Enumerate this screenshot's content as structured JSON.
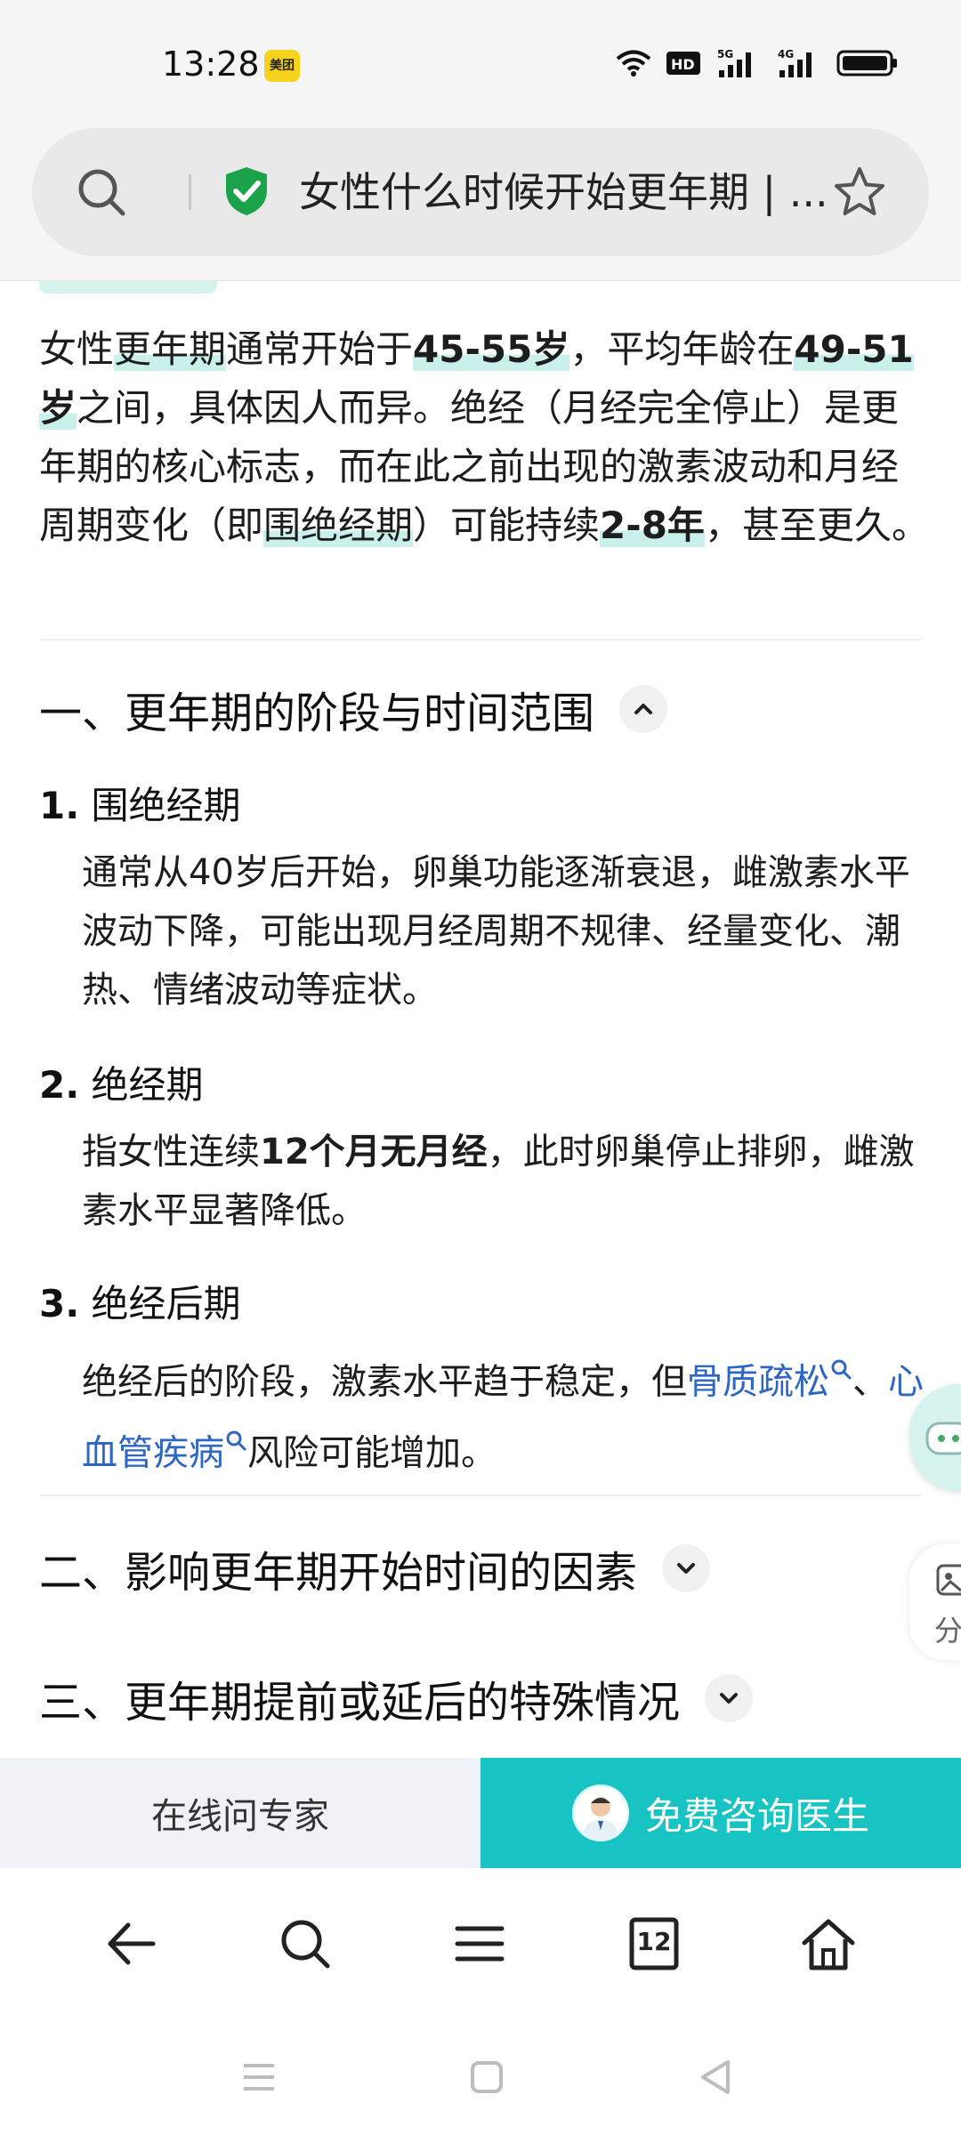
{
  "status_bar": {
    "time": "13:28",
    "app_badge": "美团"
  },
  "address_bar": {
    "title": "女性什么时候开始更年期 | ..."
  },
  "article": {
    "intro": {
      "t1": "女性",
      "t2": "更年期",
      "t3": "通常开始于",
      "t4": "45-55岁",
      "t5": "，平均年龄在",
      "t6": "49-51岁",
      "t7": "之间，具体因人而异。绝经（月经完全停止）是更年期的核心标志，而在此之前出现的激素波动和月经周期变化（即",
      "t8": "围绝经期",
      "t9": "）可能持续",
      "t10": "2-8年",
      "t11": "，甚至更久。"
    },
    "section1_title": "一、更年期的阶段与时间范围",
    "items": [
      {
        "num": "1.",
        "title": "围绝经期",
        "text": "通常从40岁后开始，卵巢功能逐渐衰退，雌激素水平波动下降，可能出现月经周期不规律、经量变化、潮热、情绪波动等症状。"
      },
      {
        "num": "2.",
        "title": "绝经期",
        "text_a": "指女性连续",
        "text_bold": "12个月无月经",
        "text_b": "，此时卵巢停止排卵，雌激素水平显著降低。"
      },
      {
        "num": "3.",
        "title": "绝经后期",
        "text_a": "绝经后的阶段，激素水平趋于稳定，但",
        "link1": "骨质疏松",
        "text_b": "、",
        "link2": "心血管疾病",
        "text_c": "风险可能增加。"
      }
    ],
    "section2_title": "二、影响更年期开始时间的因素",
    "section3_title": "三、更年期提前或延后的特殊情况"
  },
  "float": {
    "share_label": "分"
  },
  "consult_bar": {
    "left_label": "在线问专家",
    "right_label": "免费咨询医生"
  },
  "browser_nav": {
    "tabs_count": "12"
  },
  "colors": {
    "accent": "#18c3c3",
    "highlight": "#c9f0ea",
    "link": "#2e66c6"
  }
}
